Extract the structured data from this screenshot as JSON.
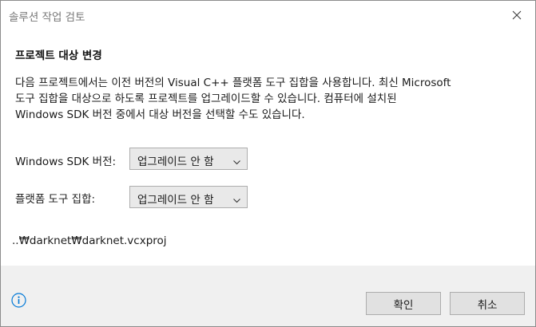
{
  "window": {
    "title": "솔루션 작업 검토",
    "close_icon": "close-icon"
  },
  "content": {
    "heading": "프로젝트 대상 변경",
    "description_lines": [
      "다음 프로젝트에서는 이전 버전의 Visual C++ 플랫폼 도구 집합을 사용합니다. 최신 Microsoft",
      "도구 집합을 대상으로 하도록 프로젝트를 업그레이드할 수 있습니다. 컴퓨터에 설치된",
      "Windows SDK 버전 중에서 대상 버전을 선택할 수도 있습니다."
    ],
    "sdk_label": "Windows SDK 버전:",
    "sdk_value": "업그레이드 안 함",
    "toolset_label": "플랫폼 도구 집합:",
    "toolset_value": "업그레이드 안 함",
    "project_path": "..₩darknet₩darknet.vcxproj"
  },
  "footer": {
    "info_icon": "info-icon",
    "ok_label": "확인",
    "cancel_label": "취소"
  },
  "colors": {
    "footer_bg": "#f0f0f0",
    "info_icon": "#0078d7",
    "button_bg": "#e1e1e1",
    "select_bg": "#e9e9e9"
  }
}
